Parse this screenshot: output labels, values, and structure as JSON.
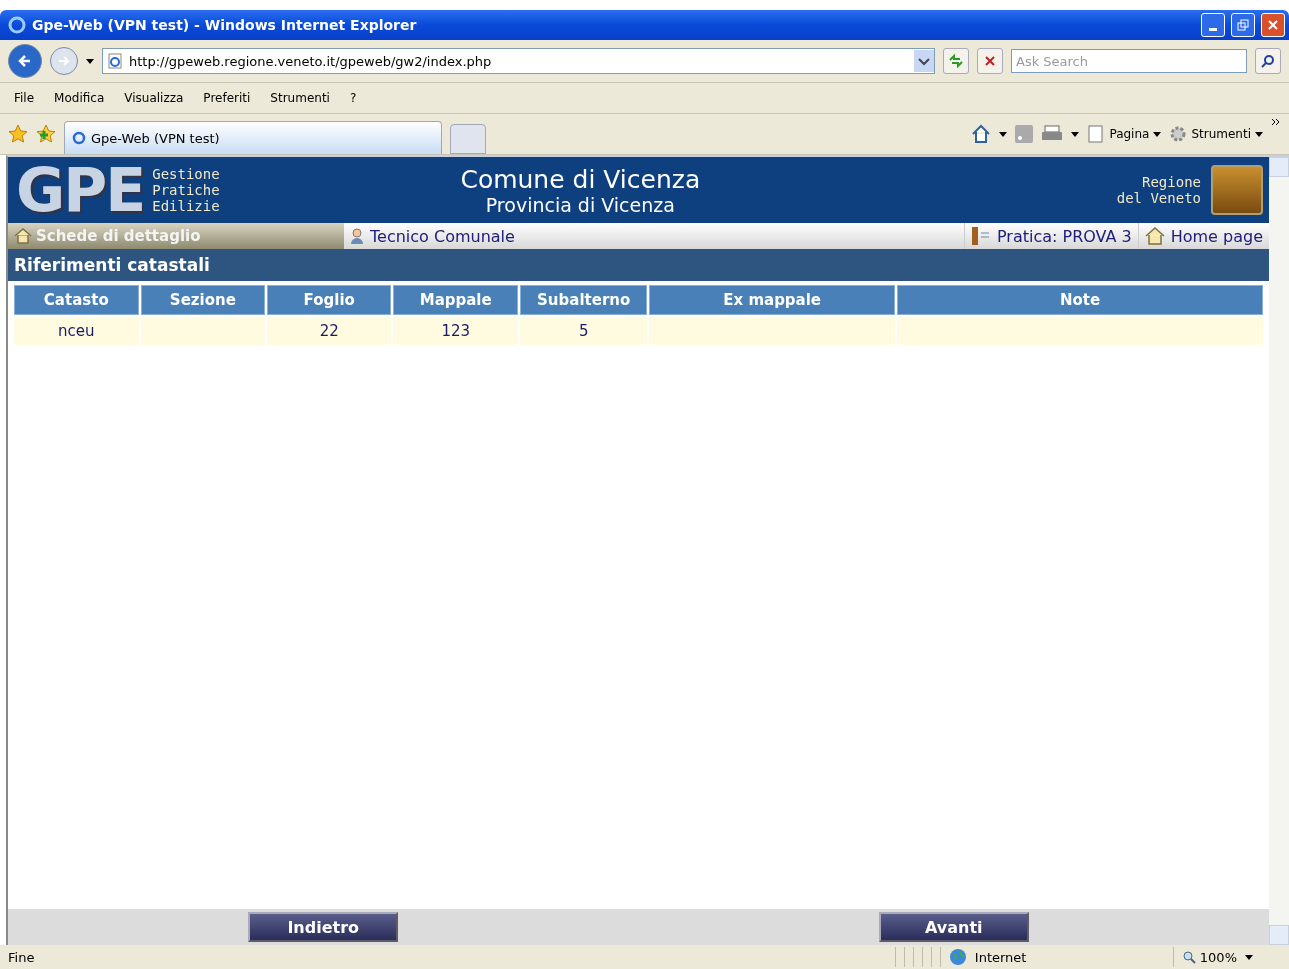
{
  "window": {
    "title": "Gpe-Web (VPN test) - Windows Internet Explorer"
  },
  "address_bar": {
    "url": "http://gpeweb.regione.veneto.it/gpeweb/gw2/index.php"
  },
  "search": {
    "placeholder": "Ask Search"
  },
  "menu": [
    "File",
    "Modifica",
    "Visualizza",
    "Preferiti",
    "Strumenti",
    "?"
  ],
  "tabs": [
    {
      "label": "Gpe-Web (VPN test)",
      "selected": true
    }
  ],
  "command_bar": [
    "Pagina",
    "Strumenti"
  ],
  "page": {
    "logo": "GPE",
    "logo_caption": [
      "Gestione",
      "Pratiche",
      "Edilizie"
    ],
    "title": "Comune di Vicenza",
    "subtitle": "Provincia di Vicenza",
    "region": [
      "Regione",
      "del Veneto"
    ],
    "nav": {
      "left": "Schede di dettaglio",
      "user": "Tecnico Comunale",
      "practice": "Pratica: PROVA 3",
      "home": "Home page"
    },
    "section_title": "Riferimenti catastali",
    "table": {
      "columns": [
        "Catasto",
        "Sezione",
        "Foglio",
        "Mappale",
        "Subalterno",
        "Ex mappale",
        "Note"
      ],
      "rows": [
        [
          "nceu",
          "",
          "22",
          "123",
          "5",
          "",
          ""
        ]
      ]
    },
    "buttons": [
      "Indietro",
      "Avanti"
    ]
  },
  "status_bar": {
    "text": "Fine",
    "zone": "Internet",
    "zoom": "100%"
  }
}
